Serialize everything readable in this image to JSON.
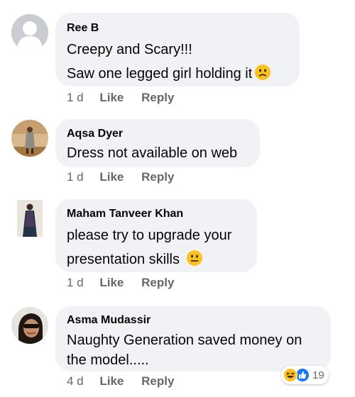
{
  "comments": [
    {
      "author": "Ree B",
      "lines": [
        "Creepy and Scary!!!",
        "Saw one legged girl holding it"
      ],
      "emoji": "slightly-frowning-face-emoji",
      "time": "1 d",
      "like_label": "Like",
      "reply_label": "Reply",
      "avatar": "default-avatar"
    },
    {
      "author": "Aqsa Dyer",
      "lines": [
        "Dress not available on web"
      ],
      "time": "1 d",
      "like_label": "Like",
      "reply_label": "Reply",
      "avatar": "photo-avatar"
    },
    {
      "author": "Maham Tanveer Khan",
      "lines": [
        "please try to upgrade your",
        "presentation skills"
      ],
      "emoji": "neutral-face-emoji",
      "time": "1 d",
      "like_label": "Like",
      "reply_label": "Reply",
      "avatar": "photo-avatar"
    },
    {
      "author": "Asma Mudassir",
      "lines": [
        "Naughty Generation saved money on",
        "the model....."
      ],
      "time": "4 d",
      "like_label": "Like",
      "reply_label": "Reply",
      "avatar": "photo-avatar",
      "reactions": {
        "icons": [
          "haha-reaction-icon",
          "like-reaction-icon"
        ],
        "count": "19"
      }
    }
  ],
  "colors": {
    "bubble": "#f0f2f5",
    "meta_text": "#65676b",
    "like_blue": "#1877f2",
    "emoji_yellow": "#fcc21b"
  }
}
